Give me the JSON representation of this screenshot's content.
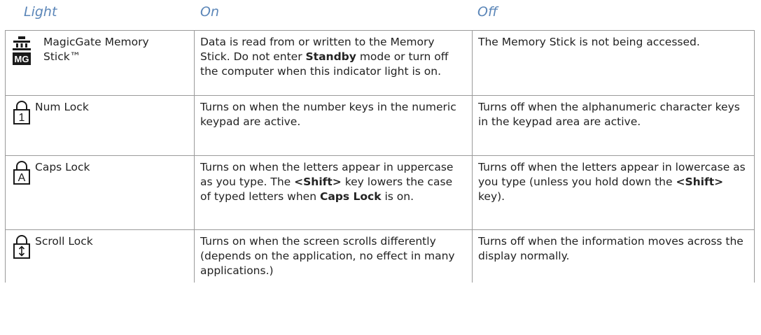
{
  "headers": {
    "light": "Light",
    "on": "On",
    "off": "Off"
  },
  "rows": [
    {
      "icon": "magicgate-icon",
      "light": "MagicGate Memory Stick™",
      "on": [
        {
          "t": "Data is read from or written to the Memory Stick. Do not enter "
        },
        {
          "t": "Standby",
          "b": true
        },
        {
          "t": " mode or turn off the computer when this indicator light is on."
        }
      ],
      "off": [
        {
          "t": "The Memory Stick is not being accessed."
        }
      ]
    },
    {
      "icon": "num-lock-icon",
      "light": "Num Lock",
      "on": [
        {
          "t": "Turns on when the number keys in the numeric keypad are active."
        }
      ],
      "off": [
        {
          "t": "Turns off when the alphanumeric character keys in the keypad area are active."
        }
      ]
    },
    {
      "icon": "caps-lock-icon",
      "light": "Caps Lock",
      "on": [
        {
          "t": "Turns on when the letters appear in uppercase as you type. The "
        },
        {
          "t": "<Shift>",
          "b": true
        },
        {
          "t": " key lowers the case of typed letters when "
        },
        {
          "t": "Caps Lock",
          "b": true
        },
        {
          "t": " is on."
        }
      ],
      "off": [
        {
          "t": "Turns off when the letters appear in lowercase as you type (unless you hold down the "
        },
        {
          "t": "<Shift>",
          "b": true
        },
        {
          "t": " key)."
        }
      ]
    },
    {
      "icon": "scroll-lock-icon",
      "light": "Scroll Lock",
      "on": [
        {
          "t": "Turns on when the screen scrolls differently (depends on the application, no effect in many applications.)"
        }
      ],
      "off": [
        {
          "t": "Turns off when the information moves across the display normally."
        }
      ]
    }
  ]
}
